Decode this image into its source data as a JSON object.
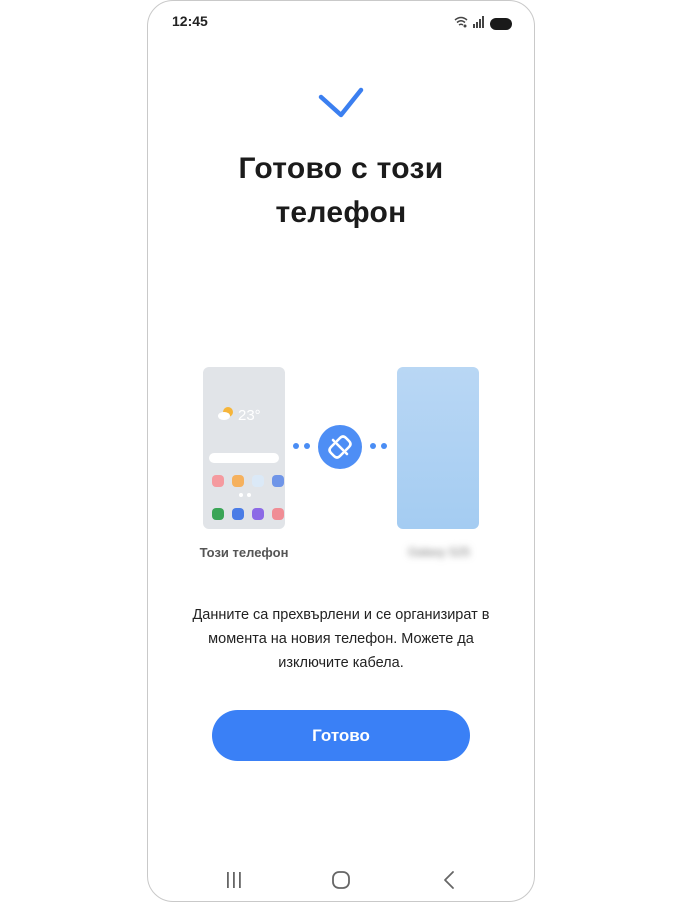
{
  "status_bar": {
    "time": "12:45",
    "icons": [
      "wifi-icon",
      "signal-icon",
      "battery-icon"
    ]
  },
  "header": {
    "icon": "check-icon",
    "title_line1": "Готово с този",
    "title_line2": "телефон"
  },
  "illustration": {
    "old_phone": {
      "weather_icon": "partly-sunny-icon",
      "temperature": "23°",
      "label": "Този телефон"
    },
    "link_icon": "unlink-icon",
    "new_phone": {
      "label": "Galaxy S25"
    }
  },
  "description": "Данните са прехвърлени и се организират в момента на новия телефон. Можете да изключите кабела.",
  "actions": {
    "done_label": "Готово"
  },
  "nav_bar": {
    "icons": [
      "recents-icon",
      "home-icon",
      "back-icon"
    ]
  },
  "colors": {
    "accent": "#3a80f6",
    "check": "#3b7ff0",
    "new_phone": "#a9cff3",
    "old_phone": "#e1e4e8"
  }
}
